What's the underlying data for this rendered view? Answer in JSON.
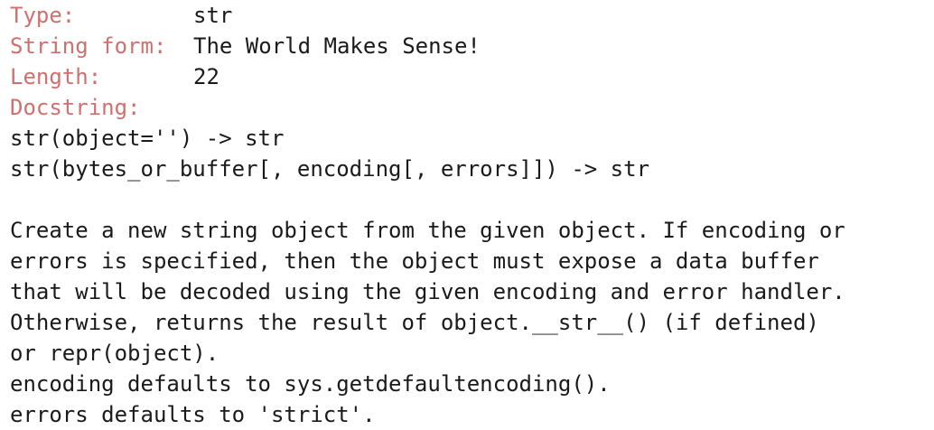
{
  "info": {
    "type_label": "Type:",
    "type_value": "str",
    "string_form_label": "String form:",
    "string_form_value": "The World Makes Sense!",
    "length_label": "Length:",
    "length_value": "22",
    "docstring_label": "Docstring:"
  },
  "docstring": {
    "signature_lines": [
      "str(object='') -> str",
      "str(bytes_or_buffer[, encoding[, errors]]) -> str"
    ],
    "body_lines": [
      "Create a new string object from the given object. If encoding or",
      "errors is specified, then the object must expose a data buffer",
      "that will be decoded using the given encoding and error handler.",
      "Otherwise, returns the result of object.__str__() (if defined)",
      "or repr(object).",
      "encoding defaults to sys.getdefaultencoding().",
      "errors defaults to 'strict'."
    ]
  },
  "colors": {
    "label": "#d0706d",
    "text": "#1a1a1a",
    "background": "#ffffff"
  }
}
